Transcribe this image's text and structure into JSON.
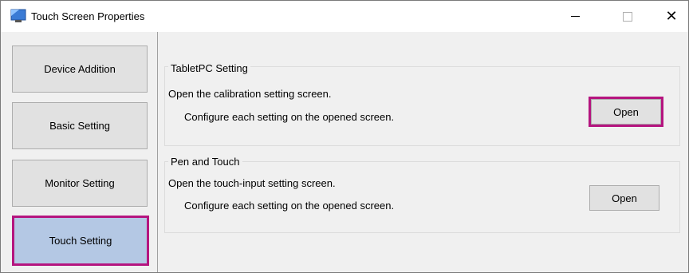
{
  "window": {
    "title": "Touch Screen Properties"
  },
  "sidebar": {
    "items": [
      {
        "label": "Device Addition"
      },
      {
        "label": "Basic Setting"
      },
      {
        "label": "Monitor Setting"
      },
      {
        "label": "Touch Setting"
      }
    ],
    "selected": "Touch Setting"
  },
  "groups": [
    {
      "title": "TabletPC Setting",
      "line1": "Open the calibration setting screen.",
      "line2": "Configure each setting on the opened screen.",
      "button_label": "Open"
    },
    {
      "title": "Pen and Touch",
      "line1": "Open the touch-input setting screen.",
      "line2": "Configure each setting on the opened screen.",
      "button_label": "Open"
    }
  ],
  "colors": {
    "highlight": "#b5157f",
    "active_nav": "#b4c8e4"
  }
}
